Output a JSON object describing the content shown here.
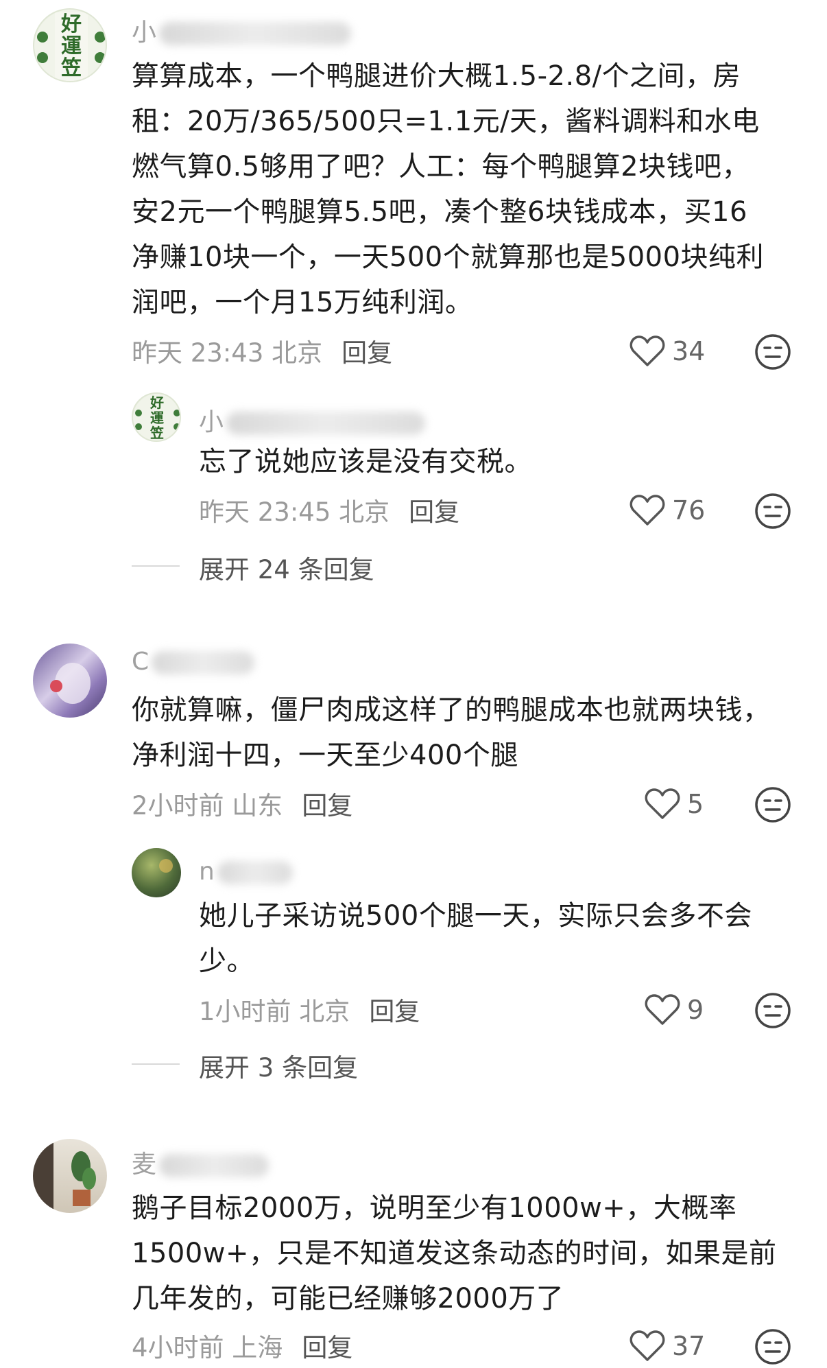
{
  "comments": [
    {
      "username": "小",
      "text": "算算成本，一个鸭腿进价大概1.5-2.8/个之间，房租：20万/365/500只=1.1元/天，酱料调料和水电燃气算0.5够用了吧？人工：每个鸭腿算2块钱吧，安2元一个鸭腿算5.5吧，凑个整6块钱成本，买16净赚10块一个，一天500个就算那也是5000块纯利润吧，一个月15万纯利润。",
      "lines": [
        "算算成本，一个鸭腿进价大概1.5-2.8/个之间，房",
        "租：20万/365/500只=1.1元/天，酱料调料和水电",
        "燃气算0.5够用了吧？人工：每个鸭腿算2块钱吧，",
        "安2元一个鸭腿算5.5吧，凑个整6块钱成本，买16",
        "净赚10块一个，一天500个就算那也是5000块纯利",
        "润吧，一个月15万纯利润。"
      ],
      "time": "昨天 23:43 北京",
      "reply": "回复",
      "likes": "34",
      "avatar_text": "好運笠"
    },
    {
      "username": "小",
      "lines": [
        "忘了说她应该是没有交税。"
      ],
      "time": "昨天 23:45 北京",
      "reply": "回复",
      "likes": "76",
      "avatar_text": "好運笠"
    },
    {
      "username": "C",
      "lines": [
        "你就算嘛，僵尸肉成这样了的鸭腿成本也就两块钱，",
        "净利润十四，一天至少400个腿"
      ],
      "time": "2小时前 山东",
      "reply": "回复",
      "likes": "5"
    },
    {
      "username": "n",
      "lines": [
        "她儿子采访说500个腿一天，实际只会多不会",
        "少。"
      ],
      "time": "1小时前 北京",
      "reply": "回复",
      "likes": "9"
    },
    {
      "username": "麦",
      "lines": [
        "鹅子目标2000万，说明至少有1000w+，大概率",
        "1500w+，只是不知道发这条动态的时间，如果是前",
        "几年发的，可能已经赚够2000万了"
      ],
      "time": "4小时前 上海",
      "reply": "回复",
      "likes": "37"
    }
  ],
  "expand_1": "展开 24 条回复",
  "expand_2": "展开 3 条回复",
  "icons": {
    "like": "heart-outline-icon",
    "emoji": "neutral-face-icon"
  }
}
